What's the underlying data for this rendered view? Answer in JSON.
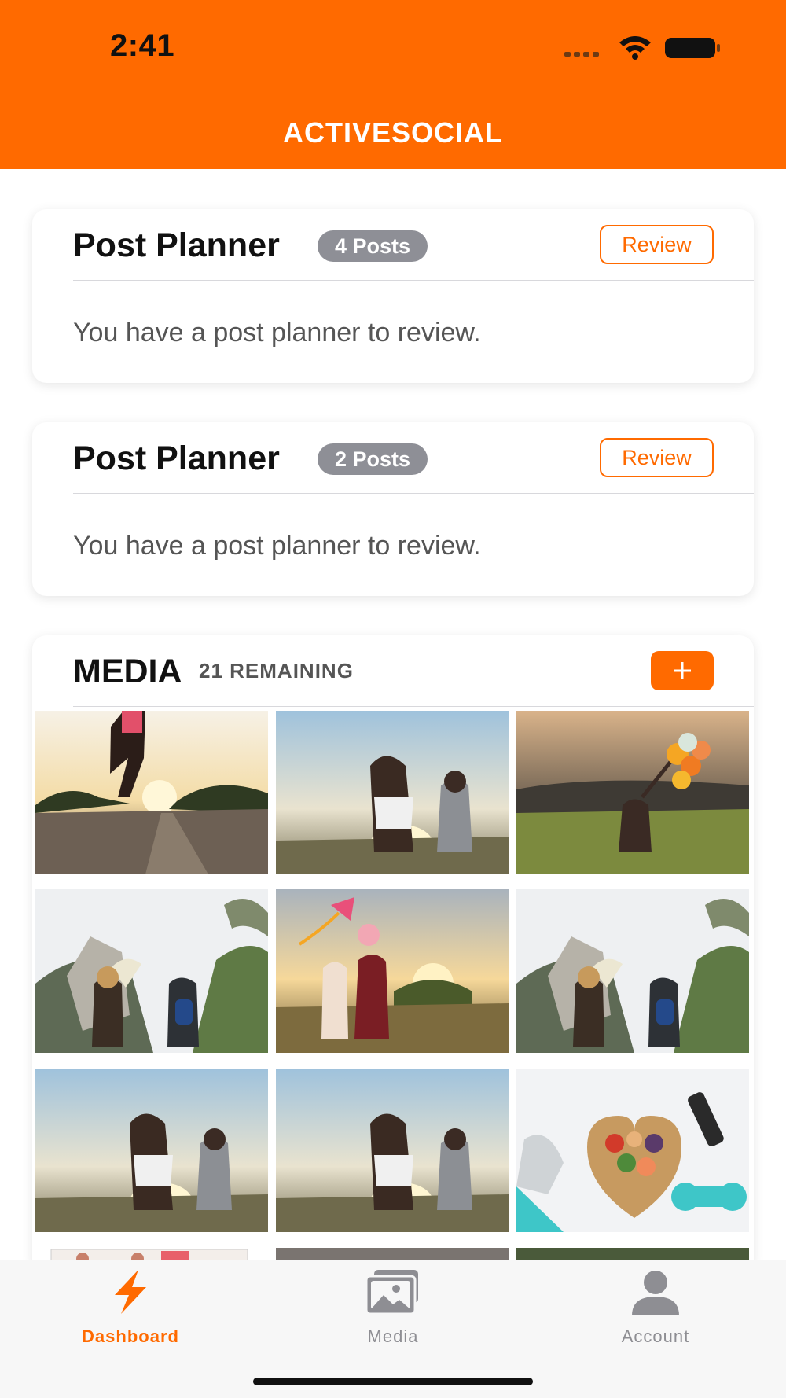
{
  "status_bar": {
    "time": "2:41"
  },
  "header": {
    "title": "ACTIVESOCIAL"
  },
  "planners": [
    {
      "title": "Post Planner",
      "badge": "4 Posts",
      "button_label": "Review",
      "message": "You have a post planner to review."
    },
    {
      "title": "Post Planner",
      "badge": "2 Posts",
      "button_label": "Review",
      "message": "You have a post planner to review."
    }
  ],
  "media": {
    "title": "MEDIA",
    "remaining": "21 REMAINING",
    "add_icon": "plus-icon",
    "thumbnails": [
      "runner-sunset-photo",
      "couple-dancing-photo",
      "balloons-field-photo",
      "hikers-cliff-photo",
      "family-kite-photo",
      "hikers-cliff-photo",
      "couple-dancing-photo",
      "couple-dancing-photo",
      "healthy-food-heart-photo"
    ]
  },
  "tabbar": {
    "tabs": [
      {
        "label": "Dashboard",
        "icon": "lightning-icon",
        "active": true
      },
      {
        "label": "Media",
        "icon": "photos-icon",
        "active": false
      },
      {
        "label": "Account",
        "icon": "person-icon",
        "active": false
      }
    ]
  },
  "colors": {
    "accent": "#ff6a00",
    "badge": "#8e8f96",
    "inactive": "#8e8e93"
  }
}
